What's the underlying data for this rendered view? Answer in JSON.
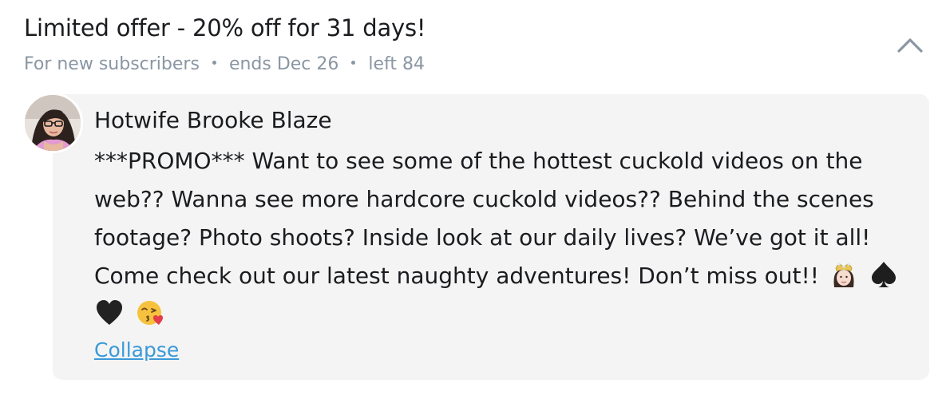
{
  "offer": {
    "title": "Limited offer - 20% off for 31 days!",
    "audience": "For new subscribers",
    "ends": "ends Dec 26",
    "left": "left 84"
  },
  "message": {
    "sender_name": "Hotwife Brooke Blaze",
    "text": "***PROMO*** Want to see some of the hottest cuckold videos on the web?? Wanna see more hardcore cuckold videos?? Behind the scenes footage? Photo shoots? Inside look at our daily lives? We’ve got it all! Come check out our latest naughty adventures! Don’t miss out!!",
    "emojis": [
      "princess-emoji",
      "spade-suit-emoji",
      "black-heart-emoji",
      "face-blowing-kiss-emoji"
    ],
    "collapse_label": "Collapse"
  },
  "icons": {
    "toggle": "chevron-up-icon",
    "avatar": "avatar"
  },
  "colors": {
    "muted_text": "#8a96a3",
    "link": "#3a9ad9",
    "card_background": "#f4f4f4",
    "primary_text": "#1a1c1f"
  }
}
